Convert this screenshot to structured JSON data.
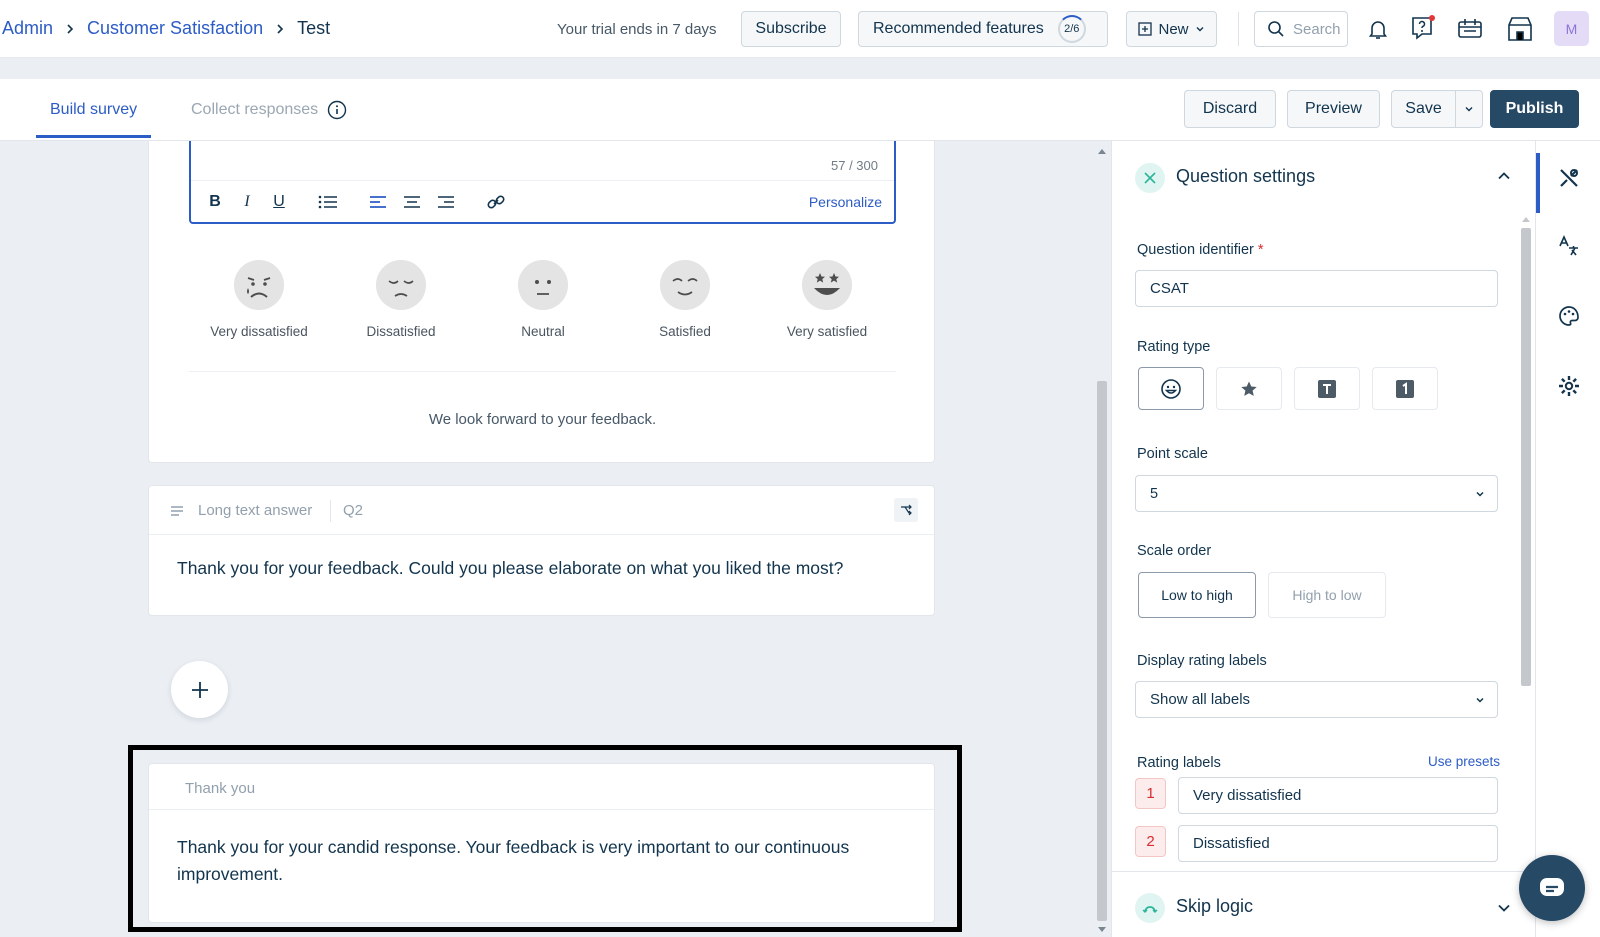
{
  "breadcrumb": {
    "admin": "Admin",
    "section": "Customer Satisfaction",
    "current": "Test"
  },
  "header": {
    "trial_text": "Your trial ends in 7 days",
    "subscribe": "Subscribe",
    "recommended": "Recommended features",
    "recommended_progress": "2/6",
    "new_label": "New",
    "search_placeholder": "Search",
    "avatar_initial": "M"
  },
  "tabs": {
    "build": "Build survey",
    "collect": "Collect responses"
  },
  "actions": {
    "discard": "Discard",
    "preview": "Preview",
    "save": "Save",
    "publish": "Publish"
  },
  "editor": {
    "char_count": "57 / 300",
    "personalize": "Personalize",
    "rating_options": [
      "Very dissatisfied",
      "Dissatisfied",
      "Neutral",
      "Satisfied",
      "Very satisfied"
    ],
    "footer_text": "We look forward to your feedback."
  },
  "q2": {
    "type": "Long text answer",
    "number": "Q2",
    "text": "Thank you for your feedback. Could you please elaborate on what you liked the most?"
  },
  "thankyou": {
    "title": "Thank you",
    "text": "Thank you for your candid response. Your feedback is very important to our continuous improvement."
  },
  "settings": {
    "title": "Question settings",
    "identifier_label": "Question identifier",
    "identifier_value": "CSAT",
    "rating_type_label": "Rating type",
    "point_scale_label": "Point scale",
    "point_scale_value": "5",
    "scale_order_label": "Scale order",
    "order_low_high": "Low to high",
    "order_high_low": "High to low",
    "display_labels_label": "Display rating labels",
    "display_labels_value": "Show all labels",
    "rating_labels_label": "Rating labels",
    "use_presets": "Use presets",
    "labels": [
      {
        "n": "1",
        "v": "Very dissatisfied"
      },
      {
        "n": "2",
        "v": "Dissatisfied"
      }
    ],
    "skip_logic": "Skip logic"
  },
  "colors": {
    "primary": "#2c5cc5",
    "publish": "#264966",
    "teal": "#2bb59b",
    "required": "#d72d30"
  }
}
